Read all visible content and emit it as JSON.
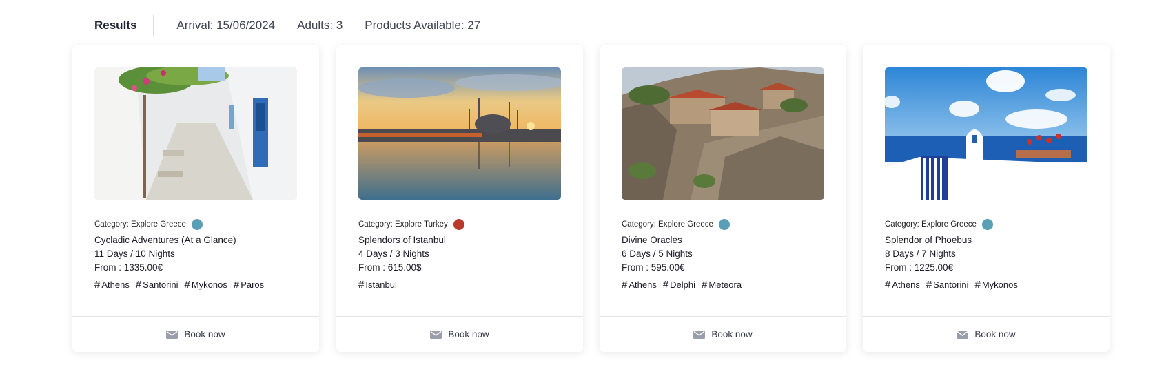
{
  "summary": {
    "results_label": "Results",
    "arrival": "Arrival: 15/06/2024",
    "adults": "Adults: 3",
    "products": "Products Available: 27"
  },
  "cards": [
    {
      "image": "whitewashed-alley-photo",
      "category": "Category: Explore Greece",
      "category_color": "#5a9fb5",
      "title": "Cycladic Adventures (At a Glance)",
      "duration": "11 Days / 10 Nights",
      "price": "From : 1335.00€",
      "tags": [
        "Athens",
        "Santorini",
        "Mykonos",
        "Paros"
      ],
      "book_label": "Book now"
    },
    {
      "image": "istanbul-sunset-photo",
      "category": "Category: Explore Turkey",
      "category_color": "#b93a2a",
      "title": "Splendors of Istanbul",
      "duration": "4 Days / 3 Nights",
      "price": "From : 615.00$",
      "tags": [
        "Istanbul"
      ],
      "book_label": "Book now"
    },
    {
      "image": "meteora-monastery-photo",
      "category": "Category: Explore Greece",
      "category_color": "#5a9fb5",
      "title": "Divine Oracles",
      "duration": "6 Days / 5 Nights",
      "price": "From : 595.00€",
      "tags": [
        "Athens",
        "Delphi",
        "Meteora"
      ],
      "book_label": "Book now"
    },
    {
      "image": "santorini-sea-photo",
      "category": "Category: Explore Greece",
      "category_color": "#5a9fb5",
      "title": "Splendor of Phoebus",
      "duration": "8 Days / 7 Nights",
      "price": "From : 1225.00€",
      "tags": [
        "Athens",
        "Santorini",
        "Mykonos"
      ],
      "book_label": "Book now"
    }
  ],
  "hash_symbol": "#"
}
